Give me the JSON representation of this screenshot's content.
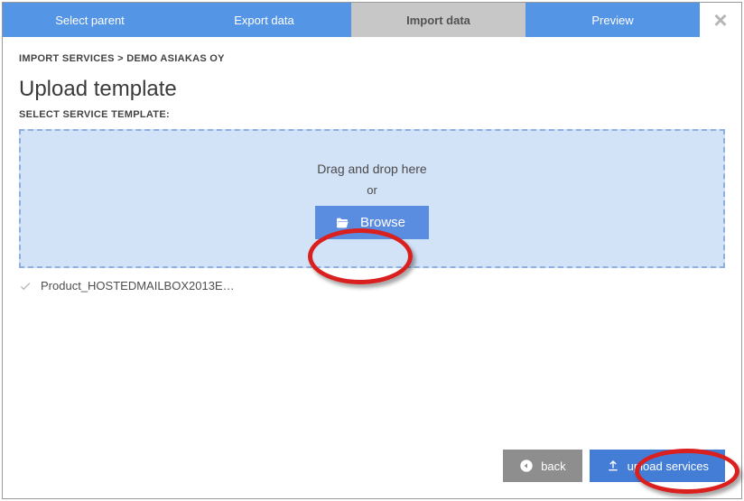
{
  "tabs": {
    "select_parent": "Select parent",
    "export_data": "Export data",
    "import_data": "Import data",
    "preview": "Preview"
  },
  "breadcrumb": "IMPORT SERVICES > DEMO ASIAKAS OY",
  "title": "Upload template",
  "subtitle": "SELECT SERVICE TEMPLATE:",
  "dropzone": {
    "line1": "Drag and drop here",
    "line2": "or",
    "browse_label": "Browse"
  },
  "file_row": {
    "name": "Product_HOSTEDMAILBOX2013E…"
  },
  "buttons": {
    "back": "back",
    "upload_services": "upload services"
  }
}
